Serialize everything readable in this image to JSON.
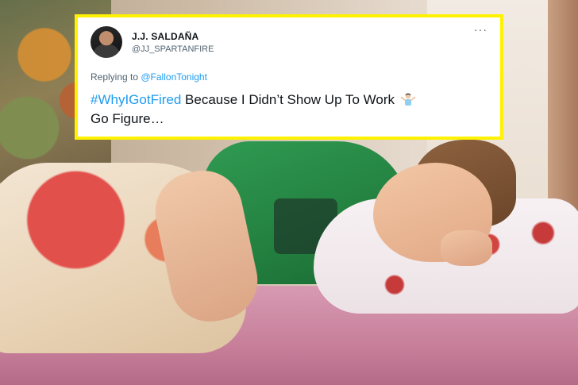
{
  "tweet": {
    "display_name": "J.J. SALDAÑA",
    "handle": "@JJ_SPARTANFIRE",
    "more_icon": "ellipsis-icon",
    "replying_prefix": "Replying to ",
    "replying_mention": "@FallonTonight",
    "hashtag": "#WhyIGotFired",
    "text_line1": " Because I Didn’t Show Up To Work ",
    "text_line2": "Go Figure…",
    "emoji": "person-shrugging-icon"
  },
  "colors": {
    "frame": "#fff200",
    "link": "#1d9bf0",
    "text": "#0f1419",
    "secondary": "#536471"
  }
}
